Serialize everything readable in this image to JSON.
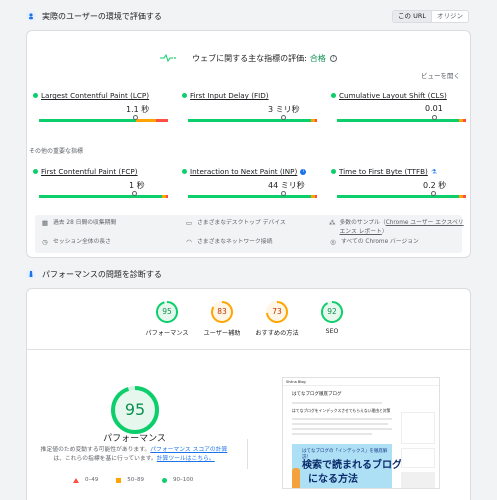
{
  "field": {
    "title": "実際のユーザーの環境で評価する",
    "toggle": {
      "this_url": "この URL",
      "origin": "オリジン"
    },
    "assessment": {
      "label": "ウェブに関する主な指標の評価:",
      "result": "合格",
      "info": "?"
    },
    "expand": "ビューを開く",
    "core_metrics": [
      {
        "name": "Largest Contentful Paint (LCP)",
        "value": "1.1 秒",
        "marker_fraction": 0.74
      },
      {
        "name": "First Input Delay (FID)",
        "value": "3 ミリ秒",
        "marker_fraction": 0.72
      },
      {
        "name": "Cumulative Layout Shift (CLS)",
        "value": "0.01",
        "marker_fraction": 0.74
      }
    ],
    "other_heading": "その他の重要な指標",
    "other_metrics": [
      {
        "name": "First Contentful Paint (FCP)",
        "value": "1 秒",
        "marker_fraction": 0.72
      },
      {
        "name": "Interaction to Next Paint (INP)",
        "value": "44 ミリ秒",
        "badge": "i",
        "marker_fraction": 0.72
      },
      {
        "name": "Time to First Byte (TTFB)",
        "value": "0.2 秒",
        "badge": "⚗",
        "marker_fraction": 0.73
      }
    ],
    "info": {
      "period": "過去 28 日間の収集期間",
      "devices": "さまざまなデスクトップ デバイス",
      "samples_prefix": "多数のサンプル（",
      "samples_link": "Chrome ユーザー エクスペリエンス レポート",
      "samples_suffix": "）",
      "session": "セッション全体の長さ",
      "network": "さまざまなネットワーク接続",
      "chrome": "すべての Chrome バージョン"
    }
  },
  "diagnose": {
    "title": "パフォーマンスの問題を診断する",
    "gauges": [
      {
        "score": "95",
        "label": "パフォーマンス",
        "color": "#0cce6b",
        "text_color": "#0d904f"
      },
      {
        "score": "83",
        "label": "ユーザー補助",
        "color": "#ffa400",
        "text_color": "#c33300"
      },
      {
        "score": "73",
        "label": "おすすめの方法",
        "color": "#ffa400",
        "text_color": "#c33300"
      },
      {
        "score": "92",
        "label": "SEO",
        "color": "#0cce6b",
        "text_color": "#0d904f"
      }
    ],
    "big": {
      "score": "95",
      "title": "パフォーマンス",
      "desc_1": "推定値のため変動する可能性があります。",
      "desc_link_1": "パフォーマンス スコアの計算",
      "desc_2": "は、これらの指標を基に行っています。",
      "desc_link_2": "計算ツールはこちら。"
    },
    "legend": {
      "fail": "0–49",
      "average": "50–89",
      "pass": "90–100"
    },
    "screenshot": {
      "site": "Shiina Blog",
      "heading": "はてなブログ徹底ブログ",
      "subtitle": "はてなブログをインデックスさせてもらえない理由と対策",
      "banner_head": "はてなブログの「インデックス」を徹底解説！",
      "banner_big1": "検索で読まれるブログ",
      "banner_big2": "になる方法"
    }
  },
  "colors": {
    "pass": "#0cce6b",
    "average": "#ffa400",
    "fail": "#ff4e42",
    "link": "#1a73e8"
  }
}
